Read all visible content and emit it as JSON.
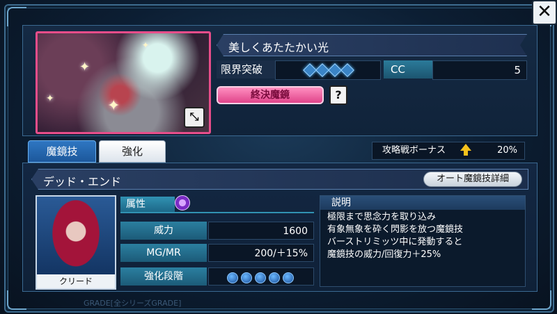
{
  "card": {
    "title": "美しくあたたかい光",
    "limit_break_label": "限界突破",
    "cc_label": "CC",
    "cc_value": "5",
    "final_mirror_label": "終決魔鏡"
  },
  "tabs": {
    "skill_tab": "魔鏡技",
    "enhance_tab": "強化"
  },
  "bonus": {
    "label": "攻略戦ボーナス",
    "value": "20%"
  },
  "skill": {
    "name": "デッド・エンド",
    "auto_details_button": "オート魔鏡技詳細"
  },
  "character": {
    "name": "クリード"
  },
  "stats": {
    "attribute_label": "属性",
    "power_label": "威力",
    "power_value": "1600",
    "mgmr_label": "MG/MR",
    "mgmr_value": "200/＋15%",
    "enhance_stage_label": "強化段階"
  },
  "description": {
    "heading": "説明",
    "lines": [
      "極限まで思念力を取り込み",
      "有象無象を砕く閃影を放つ魔鏡技",
      "バーストリミッツ中に発動すると",
      "魔鏡技の威力/回復力＋25%"
    ]
  },
  "footer_text": "GRADE[全シリーズGRADE]",
  "colors": {
    "accent_pink": "#e84d8a",
    "accent_blue": "#2f77c2",
    "bonus_arrow": "#f6c21c"
  },
  "icons": [
    "close-icon",
    "expand-icon",
    "help-icon",
    "attribute-icon",
    "up-arrow-icon",
    "diamond-icon",
    "orb-icon"
  ]
}
